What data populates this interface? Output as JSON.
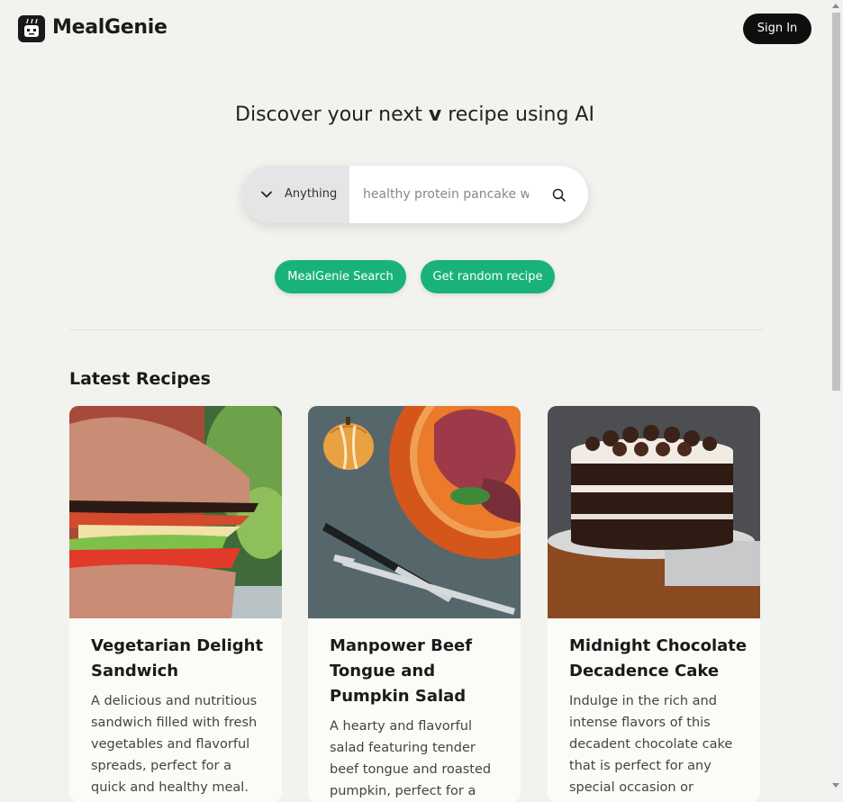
{
  "header": {
    "brand": "MealGenie",
    "signin_label": "Sign In"
  },
  "hero": {
    "headline_before": "Discover your next ",
    "headline_bold": "v",
    "headline_after": " recipe using AI"
  },
  "search": {
    "filter_label": "Anything",
    "placeholder": "healthy protein pancake w"
  },
  "actions": {
    "primary_label": "MealGenie Search",
    "random_label": "Get random recipe"
  },
  "latest": {
    "title": "Latest Recipes",
    "recipes": [
      {
        "title": "Vegetarian Delight Sandwich",
        "description": "A delicious and nutritious sandwich filled with fresh vegetables and flavorful spreads, perfect for a quick and healthy meal."
      },
      {
        "title": "Manpower Beef Tongue and Pumpkin Salad",
        "description": "A hearty and flavorful salad featuring tender beef tongue and roasted pumpkin, perfect for a satisfying meal."
      },
      {
        "title": "Midnight Chocolate Decadence Cake",
        "description": "Indulge in the rich and intense flavors of this decadent chocolate cake that is perfect for any special occasion or celebration."
      }
    ]
  },
  "icons": {
    "logo": "chef-robot-icon",
    "filter": "chevron-down-icon",
    "search": "search-icon"
  },
  "colors": {
    "accent": "#19b37a",
    "signin_bg": "#0e0e0e",
    "page_bg": "#f2f2ee"
  }
}
